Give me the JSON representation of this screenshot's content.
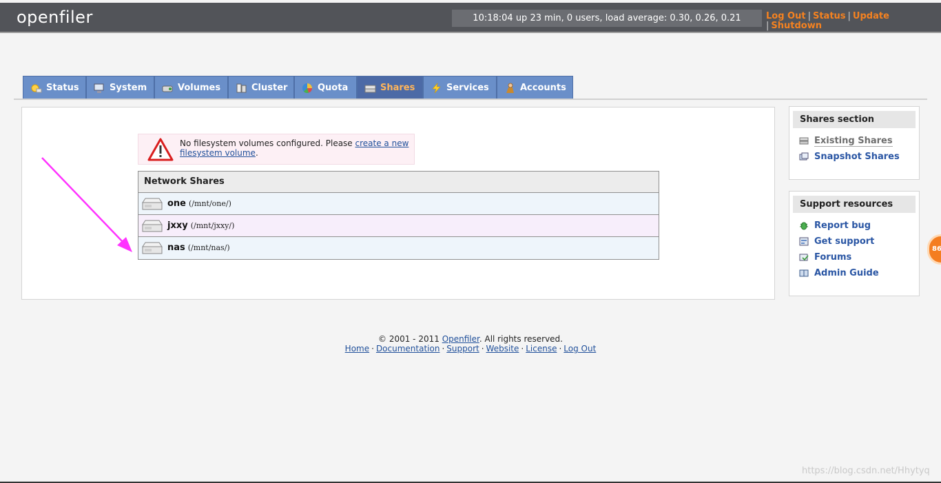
{
  "header": {
    "logo": "openfiler",
    "uptime": "10:18:04 up 23 min, 0 users, load average: 0.30, 0.26, 0.21",
    "links": [
      "Log Out",
      "Status",
      "Update",
      "Shutdown"
    ]
  },
  "tabs": [
    {
      "label": "Status",
      "icon": "sun-icon"
    },
    {
      "label": "System",
      "icon": "computer-icon"
    },
    {
      "label": "Volumes",
      "icon": "disk-icon"
    },
    {
      "label": "Cluster",
      "icon": "cluster-icon"
    },
    {
      "label": "Quota",
      "icon": "pie-icon"
    },
    {
      "label": "Shares",
      "icon": "drive-icon",
      "active": true
    },
    {
      "label": "Services",
      "icon": "lightning-icon"
    },
    {
      "label": "Accounts",
      "icon": "user-icon"
    }
  ],
  "warning": {
    "text": "No filesystem volumes configured. Please ",
    "link": "create a new filesystem volume",
    "end": "."
  },
  "shares": {
    "title": "Network Shares",
    "rows": [
      {
        "name": "one",
        "path": "(/mnt/one/)"
      },
      {
        "name": "jxxy",
        "path": "(/mnt/jxxy/)"
      },
      {
        "name": "nas",
        "path": "(/mnt/nas/)"
      }
    ]
  },
  "sidebar": {
    "shares_section": {
      "title": "Shares section",
      "items": [
        "Existing Shares",
        "Snapshot Shares"
      ]
    },
    "support": {
      "title": "Support resources",
      "items": [
        "Report bug",
        "Get support",
        "Forums",
        "Admin Guide"
      ]
    }
  },
  "footer": {
    "copyright_prefix": "© 2001 - 2011 ",
    "copyright_link": "Openfiler",
    "copyright_suffix": ". All rights reserved.",
    "links": [
      "Home",
      "Documentation",
      "Support",
      "Website",
      "License",
      "Log Out"
    ]
  },
  "badge": "86",
  "watermark": "https://blog.csdn.net/Hhytyq",
  "colors": {
    "topbar": "#525459",
    "tab": "#6a8fc9",
    "tab_active": "#4c6aa6",
    "tab_active_text": "#ffb55a",
    "link_orange": "#f58220",
    "link_blue": "#2a56a4",
    "arrow": "#ff33ff"
  }
}
